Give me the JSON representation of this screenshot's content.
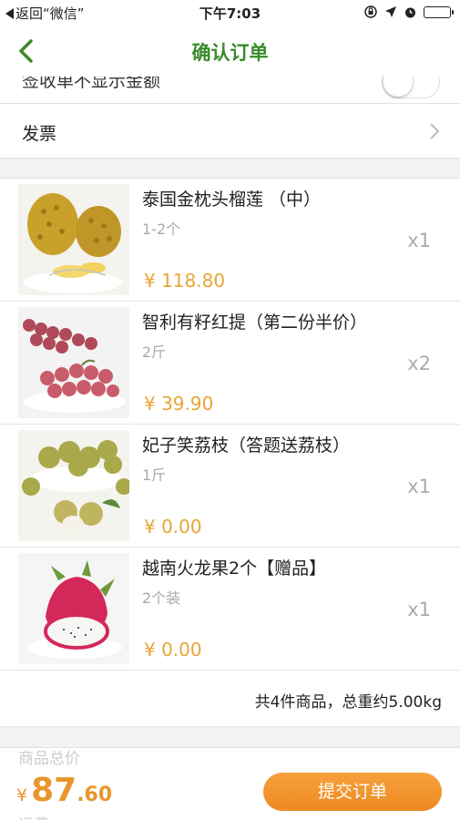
{
  "status_bar": {
    "back_app": "返回“微信”",
    "time": "下午7:03"
  },
  "nav": {
    "title": "确认订单",
    "back_icon": "chevron-left-icon",
    "title_color": "#3a8a2b"
  },
  "settings": {
    "hide_amount_label": "签收单不显示金额",
    "hide_amount_toggle": "off",
    "invoice_label": "发票"
  },
  "products": [
    {
      "name": "泰国金枕头榴莲 （中）",
      "spec": "1-2个",
      "price": "¥ 118.80",
      "qty": "x1",
      "image": "durian"
    },
    {
      "name": "智利有籽红提（第二份半价）",
      "spec": "2斤",
      "price": "¥ 39.90",
      "qty": "x2",
      "image": "red-grapes"
    },
    {
      "name": "妃子笑荔枝（答题送荔枝）",
      "spec": "1斤",
      "price": "¥ 0.00",
      "qty": "x1",
      "image": "lychee"
    },
    {
      "name": "越南火龙果2个【赠品】",
      "spec": "2个装",
      "price": "¥ 0.00",
      "qty": "x1",
      "image": "dragon-fruit"
    }
  ],
  "summary": "共4件商品，总重约5.00kg",
  "footer": {
    "label_top": "商品总价",
    "label_bottom": "运费",
    "currency": "¥",
    "total_int": "87",
    "total_dec": ".60",
    "submit_label": "提交订单",
    "accent_color": "#e8962c"
  }
}
